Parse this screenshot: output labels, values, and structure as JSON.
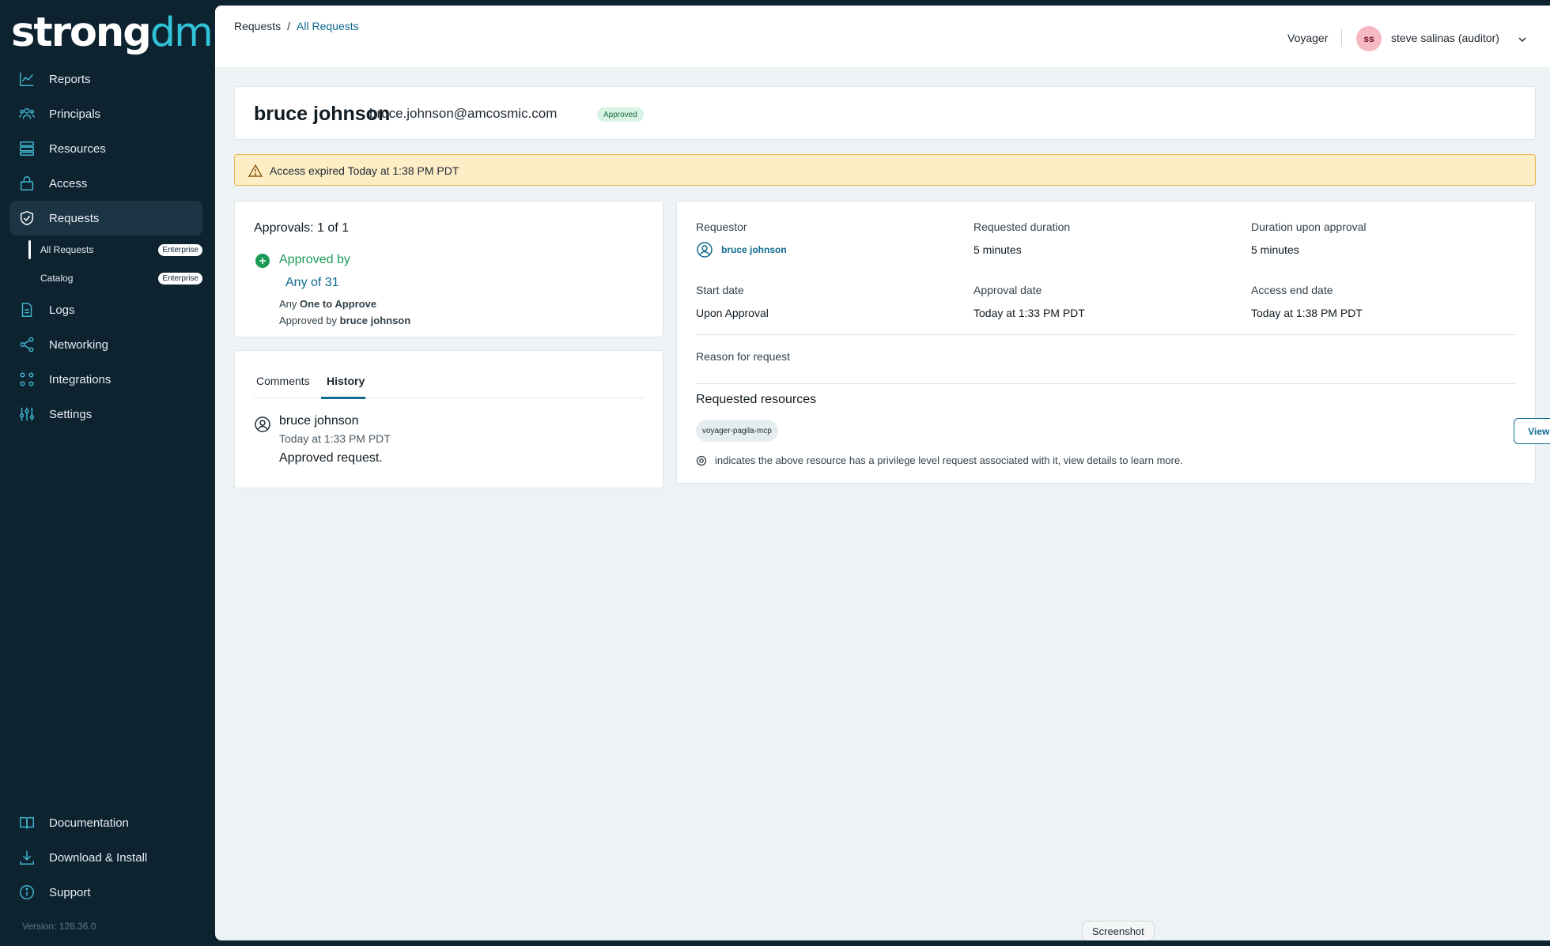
{
  "app": {
    "logo_text_a": "strong",
    "logo_text_b": "dm",
    "version": "Version: 128.36.0"
  },
  "sidebar": {
    "items": [
      {
        "label": "Reports",
        "icon": "chart-line-icon"
      },
      {
        "label": "Principals",
        "icon": "users-icon"
      },
      {
        "label": "Resources",
        "icon": "servers-icon"
      },
      {
        "label": "Access",
        "icon": "lock-icon"
      },
      {
        "label": "Requests",
        "icon": "shield-check-icon"
      },
      {
        "label": "Logs",
        "icon": "document-icon"
      },
      {
        "label": "Networking",
        "icon": "share-nodes-icon"
      },
      {
        "label": "Integrations",
        "icon": "grid-nodes-icon"
      },
      {
        "label": "Settings",
        "icon": "sliders-icon"
      }
    ],
    "sub_items": [
      {
        "label": "All Requests",
        "badge": "Enterprise"
      },
      {
        "label": "Catalog",
        "badge": "Enterprise"
      }
    ],
    "bottom_items": [
      {
        "label": "Documentation",
        "icon": "book-icon"
      },
      {
        "label": "Download & Install",
        "icon": "download-icon"
      },
      {
        "label": "Support",
        "icon": "info-icon"
      }
    ]
  },
  "topbar": {
    "breadcrumb_root": "Requests",
    "breadcrumb_sep": "/",
    "breadcrumb_current": "All Requests",
    "org": "Voyager",
    "avatar_initials": "ss",
    "username": "steve salinas (auditor)"
  },
  "request": {
    "name": "bruce johnson",
    "email": "bruce.johnson@amcosmic.com",
    "status": "Approved"
  },
  "alert": {
    "text": "Access expired Today at 1:38 PM PDT"
  },
  "approvals": {
    "title": "Approvals: 1 of 1",
    "approved_by": "Approved by",
    "group": "Any of 31",
    "rule_prefix": "Any",
    "rule_bold": "One to Approve",
    "approver_prefix": "Approved by",
    "approver_name": "bruce johnson"
  },
  "history": {
    "tabs": [
      "Comments",
      "History"
    ],
    "active_tab": "History",
    "entry": {
      "name": "bruce johnson",
      "time": "Today at 1:33 PM PDT",
      "text": "Approved request."
    }
  },
  "details": {
    "requestor_label": "Requestor",
    "requestor_value": "bruce johnson",
    "requested_duration_label": "Requested duration",
    "requested_duration_value": "5 minutes",
    "duration_upon_approval_label": "Duration upon approval",
    "duration_upon_approval_value": "5 minutes",
    "start_date_label": "Start date",
    "start_date_value": "Upon Approval",
    "approval_date_label": "Approval date",
    "approval_date_value": "Today at 1:33 PM PDT",
    "access_end_date_label": "Access end date",
    "access_end_date_value": "Today at 1:38 PM PDT",
    "reason_label": "Reason for request",
    "resources_title": "Requested resources",
    "resource_chip": "voyager-pagila-mcp",
    "view_details": "View details",
    "note": "indicates the above resource has a privilege level request associated with it, view details to learn more."
  },
  "tooltip": {
    "text": "Screenshot"
  },
  "colors": {
    "sidebar_bg": "#0d2330",
    "accent": "#0e6a8f",
    "logo_accent": "#33c3d9",
    "success": "#1a9a55",
    "warning_bg": "#fdeec5"
  }
}
